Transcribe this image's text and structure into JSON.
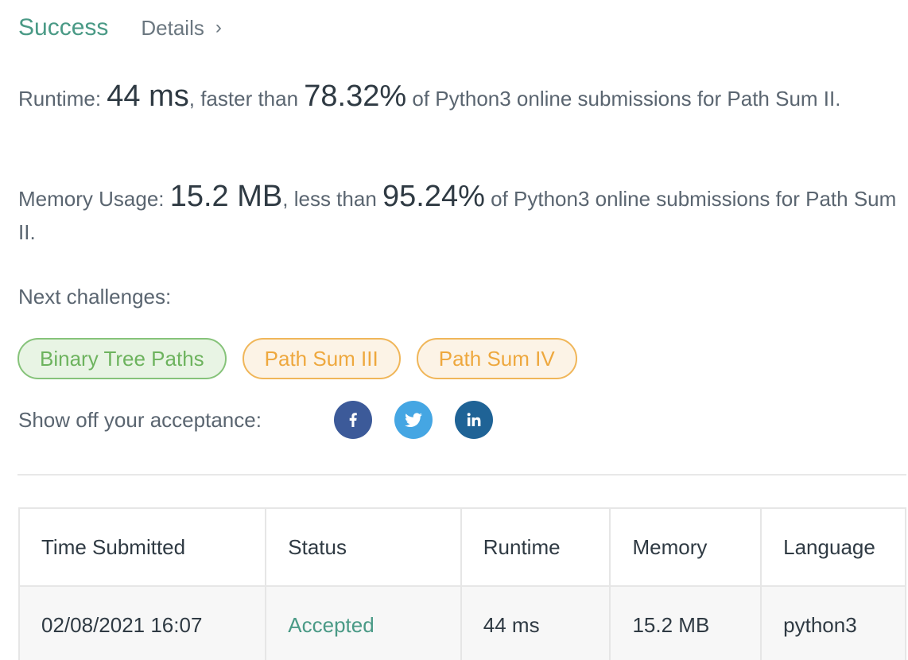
{
  "header": {
    "status": "Success",
    "details_label": "Details",
    "chevron": "›"
  },
  "runtime": {
    "label": "Runtime: ",
    "value": "44 ms",
    "middle": ", faster than ",
    "percent": "78.32%",
    "suffix": " of Python3 online submissions for Path Sum II."
  },
  "memory": {
    "label": "Memory Usage: ",
    "value": "15.2 MB",
    "middle": ", less than ",
    "percent": "95.24%",
    "suffix": " of Python3 online submissions for Path Sum II."
  },
  "next_challenges": {
    "label": "Next challenges:",
    "items": [
      {
        "label": "Binary Tree Paths",
        "difficulty_color": "#6db35e"
      },
      {
        "label": "Path Sum III",
        "difficulty_color": "#eea83e"
      },
      {
        "label": "Path Sum IV",
        "difficulty_color": "#eea83e"
      }
    ]
  },
  "share": {
    "label": "Show off your acceptance:",
    "icons": [
      "facebook-icon",
      "twitter-icon",
      "linkedin-icon"
    ]
  },
  "table": {
    "headers": [
      "Time Submitted",
      "Status",
      "Runtime",
      "Memory",
      "Language"
    ],
    "rows": [
      {
        "time": "02/08/2021 16:07",
        "status": "Accepted",
        "runtime": "44 ms",
        "memory": "15.2 MB",
        "language": "python3"
      }
    ]
  },
  "colors": {
    "success": "#4a9a86",
    "easy": "#6db35e",
    "medium": "#eea83e"
  }
}
